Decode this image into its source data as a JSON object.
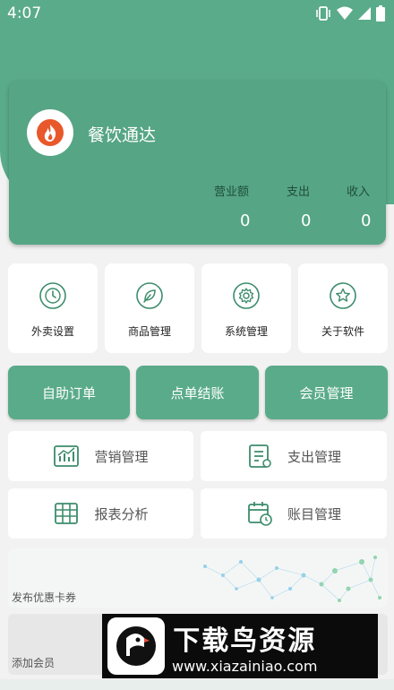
{
  "status": {
    "time": "4:07"
  },
  "header": {
    "app_name": "餐饮通达"
  },
  "stats": [
    {
      "label": "营业额",
      "value": "0"
    },
    {
      "label": "支出",
      "value": "0"
    },
    {
      "label": "收入",
      "value": "0"
    }
  ],
  "tiles": [
    {
      "label": "外卖设置",
      "icon": "clock-icon"
    },
    {
      "label": "商品管理",
      "icon": "leaf-icon"
    },
    {
      "label": "系统管理",
      "icon": "gear-icon"
    },
    {
      "label": "关于软件",
      "icon": "star-icon"
    }
  ],
  "actions": {
    "self_order": "自助订单",
    "order_checkout": "点单结账",
    "member_mgmt": "会员管理"
  },
  "menu": {
    "marketing": "营销管理",
    "expense": "支出管理",
    "report": "报表分析",
    "accounts": "账目管理"
  },
  "banners": {
    "coupon": "发布优惠卡券",
    "add_member": "添加会员"
  },
  "watermark": {
    "title": "下载鸟资源",
    "url": "www.xiazainiao.com"
  },
  "colors": {
    "primary": "#5aab8a",
    "card": "#56a585",
    "icon": "#3d8c6c"
  }
}
